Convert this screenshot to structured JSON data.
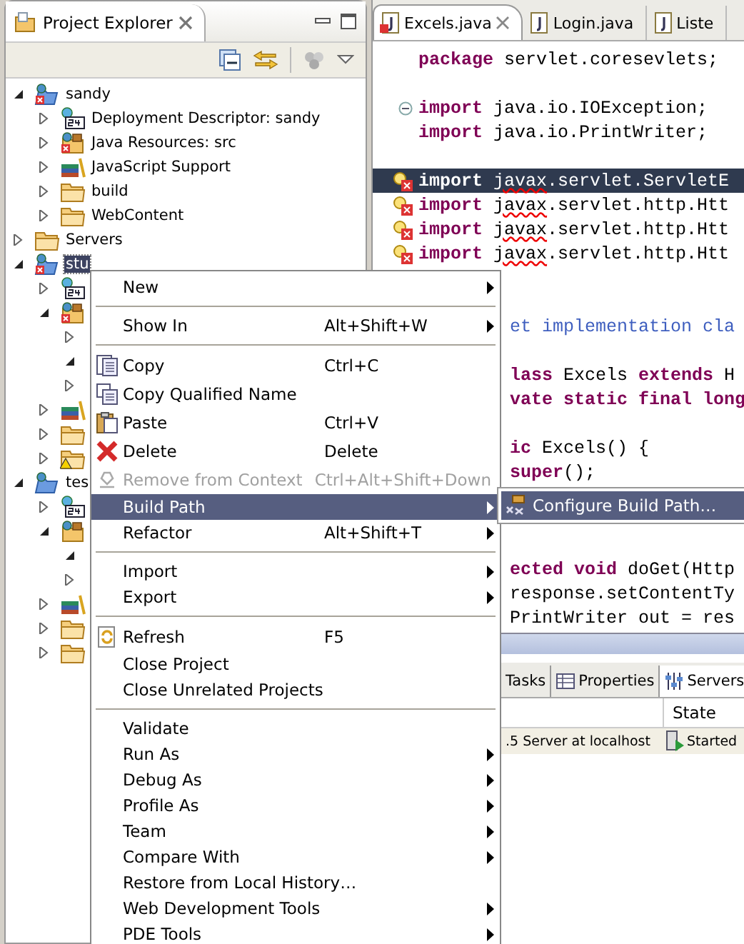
{
  "explorer": {
    "title": "Project Explorer",
    "tree": [
      {
        "label": "sandy",
        "kind": "project",
        "error": true,
        "expanded": true,
        "selected": false,
        "children": [
          {
            "label": "Deployment Descriptor: sandy",
            "kind": "descriptor",
            "expanded": false,
            "selected": false
          },
          {
            "label": "Java Resources: src",
            "kind": "java-resources",
            "error": true,
            "expanded": false,
            "selected": false
          },
          {
            "label": "JavaScript Support",
            "kind": "javascript",
            "expanded": false,
            "selected": false
          },
          {
            "label": "build",
            "kind": "folder",
            "expanded": false,
            "selected": false
          },
          {
            "label": "WebContent",
            "kind": "folder",
            "expanded": false,
            "selected": false
          }
        ]
      },
      {
        "label": "Servers",
        "kind": "folder",
        "expanded": false,
        "selected": false
      },
      {
        "label": "stu",
        "kind": "project",
        "error": true,
        "expanded": true,
        "selected": true,
        "children": [
          {
            "kind": "descriptor",
            "expanded": false
          },
          {
            "kind": "java-resources",
            "error": true,
            "expanded": true,
            "children": [
              {
                "expanded": false
              },
              {
                "expanded": true
              },
              {
                "expanded": false
              }
            ]
          },
          {
            "kind": "javascript",
            "expanded": false
          },
          {
            "kind": "folder",
            "expanded": false
          },
          {
            "kind": "folder-warning",
            "expanded": false
          }
        ]
      },
      {
        "label": "tes",
        "kind": "project",
        "error": false,
        "expanded": true,
        "selected": false,
        "children": [
          {
            "kind": "descriptor",
            "expanded": false
          },
          {
            "kind": "java-resources",
            "error": false,
            "expanded": true,
            "children": [
              {
                "expanded": true
              },
              {
                "expanded": false
              }
            ]
          },
          {
            "kind": "javascript",
            "expanded": false
          },
          {
            "kind": "folder",
            "expanded": false
          },
          {
            "kind": "folder",
            "expanded": false
          }
        ]
      }
    ]
  },
  "editor": {
    "tabs": [
      {
        "label": "Excels.java",
        "selected": true,
        "error": true
      },
      {
        "label": "Login.java",
        "selected": false,
        "error": false
      },
      {
        "label": "Liste",
        "selected": false,
        "error": false
      }
    ],
    "lines": [
      {
        "kind": "code",
        "selected": false,
        "tokens": [
          {
            "kind": "keyword",
            "text": "package"
          },
          {
            "kind": "plain",
            "text": " servlet.coresevlets;"
          }
        ]
      },
      {
        "kind": "blank"
      },
      {
        "kind": "code",
        "selected": false,
        "expanded": true,
        "tokens": [
          {
            "kind": "keyword",
            "text": "import"
          },
          {
            "kind": "plain",
            "text": " java.io.IOException;"
          }
        ]
      },
      {
        "kind": "code",
        "selected": false,
        "tokens": [
          {
            "kind": "keyword",
            "text": "import"
          },
          {
            "kind": "plain",
            "text": " java.io.PrintWriter;"
          }
        ]
      },
      {
        "kind": "blank"
      },
      {
        "kind": "code",
        "selected": true,
        "error": true,
        "tokens": [
          {
            "kind": "keyword",
            "text": "import "
          },
          {
            "kind": "error",
            "text": "javax"
          },
          {
            "kind": "plain",
            "text": ".servlet.ServletE"
          }
        ]
      },
      {
        "kind": "code",
        "selected": false,
        "error": true,
        "tokens": [
          {
            "kind": "keyword",
            "text": "import "
          },
          {
            "kind": "error",
            "text": "javax"
          },
          {
            "kind": "plain",
            "text": ".servlet.http.Htt"
          }
        ]
      },
      {
        "kind": "code",
        "selected": false,
        "error": true,
        "tokens": [
          {
            "kind": "keyword",
            "text": "import "
          },
          {
            "kind": "error",
            "text": "javax"
          },
          {
            "kind": "plain",
            "text": ".servlet.http.Htt"
          }
        ]
      },
      {
        "kind": "code",
        "selected": false,
        "error": true,
        "tokens": [
          {
            "kind": "keyword",
            "text": "import "
          },
          {
            "kind": "error",
            "text": "javax"
          },
          {
            "kind": "plain",
            "text": ".servlet.http.Htt"
          }
        ]
      },
      {
        "kind": "blank"
      },
      {
        "kind": "blank"
      },
      {
        "kind": "partial",
        "selected": false,
        "tokens": [
          {
            "kind": "comment",
            "text": "et implementation cla"
          }
        ]
      },
      {
        "kind": "blank"
      },
      {
        "kind": "partial",
        "selected": false,
        "tokens": [
          {
            "kind": "keyword",
            "text": "lass"
          },
          {
            "kind": "plain",
            "text": " Excels "
          },
          {
            "kind": "keyword",
            "text": "extends"
          },
          {
            "kind": "plain",
            "text": " H"
          }
        ]
      },
      {
        "kind": "partial",
        "selected": false,
        "tokens": [
          {
            "kind": "keyword",
            "text": "vate static final long"
          }
        ]
      },
      {
        "kind": "blank"
      },
      {
        "kind": "partial",
        "selected": false,
        "tokens": [
          {
            "kind": "keyword",
            "text": "ic"
          },
          {
            "kind": "plain",
            "text": " Excels() {"
          }
        ]
      },
      {
        "kind": "partial",
        "selected": false,
        "tokens": [
          {
            "kind": "keyword",
            "text": "super"
          },
          {
            "kind": "plain",
            "text": "();"
          }
        ]
      },
      {
        "kind": "blank"
      },
      {
        "kind": "blank"
      },
      {
        "kind": "blank"
      },
      {
        "kind": "partial",
        "selected": false,
        "tokens": [
          {
            "kind": "keyword",
            "text": "ected void"
          },
          {
            "kind": "plain",
            "text": " doGet(Http"
          }
        ]
      },
      {
        "kind": "partial",
        "selected": false,
        "tokens": [
          {
            "kind": "plain",
            "text": "response.setContentTy"
          }
        ]
      },
      {
        "kind": "partial",
        "selected": false,
        "tokens": [
          {
            "kind": "plain",
            "text": "PrintWriter out = res"
          }
        ]
      }
    ]
  },
  "bottom_panel": {
    "tabs": [
      {
        "label": "Tasks",
        "selected": false
      },
      {
        "label": "Properties",
        "selected": false
      },
      {
        "label": "Servers",
        "selected": true
      }
    ],
    "columns": [
      "",
      "State"
    ],
    "rows": [
      {
        "cells": [
          ".5 Server at localhost",
          "Started"
        ]
      }
    ]
  },
  "context_menu": {
    "items": [
      {
        "kind": "item",
        "label": "New",
        "submenu": true,
        "selected": false,
        "disabled": false
      },
      {
        "kind": "separator"
      },
      {
        "kind": "item",
        "label": "Show In",
        "shortcut": "Alt+Shift+W",
        "submenu": true,
        "selected": false,
        "disabled": false
      },
      {
        "kind": "separator"
      },
      {
        "kind": "copy",
        "label": "Copy",
        "shortcut": "Ctrl+C",
        "selected": false,
        "disabled": false
      },
      {
        "kind": "copy-qualified",
        "label": "Copy Qualified Name",
        "selected": false,
        "disabled": false
      },
      {
        "kind": "paste",
        "label": "Paste",
        "shortcut": "Ctrl+V",
        "selected": false,
        "disabled": false
      },
      {
        "kind": "delete",
        "label": "Delete",
        "shortcut": "Delete",
        "selected": false,
        "disabled": false
      },
      {
        "kind": "remove",
        "label": "Remove from Context",
        "shortcut": "Ctrl+Alt+Shift+Down",
        "selected": false,
        "disabled": true
      },
      {
        "kind": "item",
        "label": "Build Path",
        "submenu": true,
        "selected": true,
        "disabled": false
      },
      {
        "kind": "item",
        "label": "Refactor",
        "shortcut": "Alt+Shift+T",
        "submenu": true,
        "selected": false,
        "disabled": false
      },
      {
        "kind": "separator"
      },
      {
        "kind": "item",
        "label": "Import",
        "submenu": true,
        "selected": false,
        "disabled": false
      },
      {
        "kind": "item",
        "label": "Export",
        "submenu": true,
        "selected": false,
        "disabled": false
      },
      {
        "kind": "separator"
      },
      {
        "kind": "refresh",
        "label": "Refresh",
        "shortcut": "F5",
        "selected": false,
        "disabled": false
      },
      {
        "kind": "item",
        "label": "Close Project",
        "selected": false,
        "disabled": false
      },
      {
        "kind": "item",
        "label": "Close Unrelated Projects",
        "selected": false,
        "disabled": false
      },
      {
        "kind": "separator"
      },
      {
        "kind": "item",
        "label": "Validate",
        "selected": false,
        "disabled": false
      },
      {
        "kind": "item",
        "label": "Run As",
        "submenu": true,
        "selected": false,
        "disabled": false
      },
      {
        "kind": "item",
        "label": "Debug As",
        "submenu": true,
        "selected": false,
        "disabled": false
      },
      {
        "kind": "item",
        "label": "Profile As",
        "submenu": true,
        "selected": false,
        "disabled": false
      },
      {
        "kind": "item",
        "label": "Team",
        "submenu": true,
        "selected": false,
        "disabled": false
      },
      {
        "kind": "item",
        "label": "Compare With",
        "submenu": true,
        "selected": false,
        "disabled": false
      },
      {
        "kind": "item",
        "label": "Restore from Local History…",
        "selected": false,
        "disabled": false
      },
      {
        "kind": "item",
        "label": "Web Development Tools",
        "submenu": true,
        "selected": false,
        "disabled": false
      },
      {
        "kind": "item",
        "label": "PDE Tools",
        "submenu": true,
        "selected": false,
        "disabled": false
      }
    ]
  },
  "submenu": {
    "items": [
      {
        "label": "Configure Build Path…",
        "selected": true
      }
    ]
  }
}
